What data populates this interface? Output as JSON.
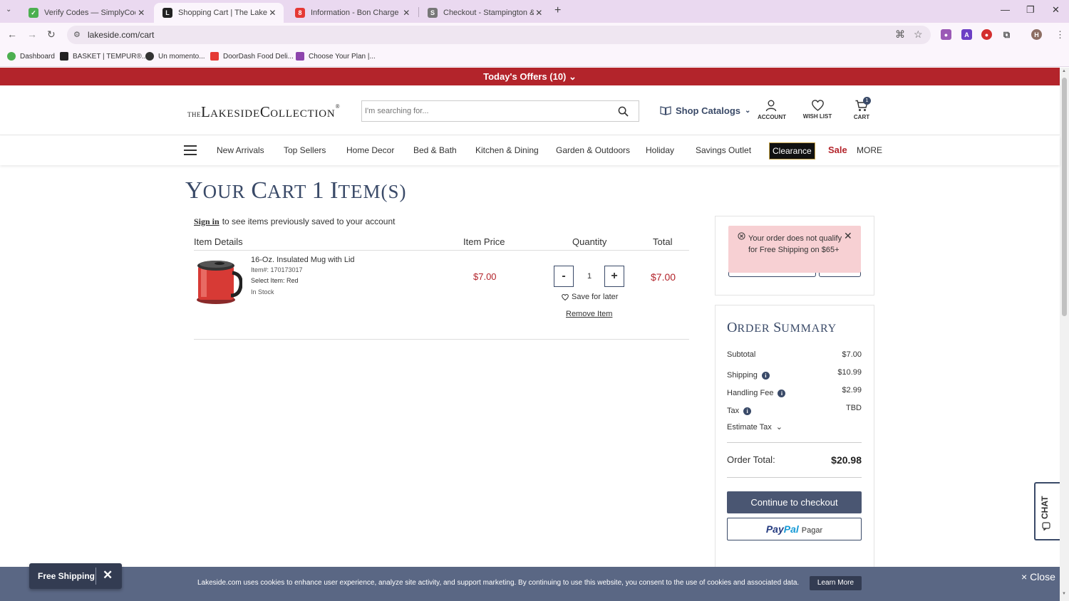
{
  "browser": {
    "tabs": [
      {
        "title": "Verify Codes — SimplyCodes",
        "fav_color": "#4caf50",
        "fav_glyph": "✓"
      },
      {
        "title": "Shopping Cart | The Lakeside C",
        "fav_color": "#222222",
        "fav_glyph": "L"
      },
      {
        "title": "Information - Bon Charge - Che",
        "fav_color": "#e53935",
        "fav_glyph": "8"
      },
      {
        "title": "Checkout - Stampington & Com",
        "fav_color": "#777777",
        "fav_glyph": "S"
      }
    ],
    "url": "lakeside.com/cart",
    "bookmarks": [
      {
        "label": "Dashboard",
        "color": "#4caf50"
      },
      {
        "label": "BASKET | TEMPUR®...",
        "color": "#222222"
      },
      {
        "label": "Un momento...",
        "color": "#333333"
      },
      {
        "label": "DoorDash Food Deli...",
        "color": "#e53935"
      },
      {
        "label": "Choose Your Plan |...",
        "color": "#8e44ad"
      }
    ]
  },
  "offers_banner": "Today's Offers (10) ⌄",
  "header": {
    "logo": {
      "the": "THE",
      "l": "L",
      "akeside": "AKESIDE",
      "c": "C",
      "ollection": "OLLECTION",
      "reg": "®"
    },
    "search_placeholder": "I'm searching for...",
    "shop_catalogs": "Shop Catalogs",
    "account": "ACCOUNT",
    "wishlist": "WISH LIST",
    "cart": "CART",
    "cart_count": "1"
  },
  "nav": [
    "New Arrivals",
    "Top Sellers",
    "Home Decor",
    "Bed & Bath",
    "Kitchen & Dining",
    "Garden & Outdoors",
    "Holiday",
    "Savings Outlet"
  ],
  "nav_clearance": "Clearance",
  "nav_sale": "Sale",
  "nav_more": "MORE",
  "cart": {
    "title_y": "Y",
    "title_our": "OUR ",
    "title_c": "C",
    "title_art": "ART ",
    "title_1": "1 ",
    "title_i": "I",
    "title_tems": "TEM(S)",
    "signin_link": "Sign in",
    "signin_text": "to see items previously saved to your account",
    "columns": {
      "details": "Item Details",
      "price": "Item Price",
      "quantity": "Quantity",
      "total": "Total"
    },
    "item": {
      "name": "16-Oz. Insulated Mug with Lid",
      "number": "Item#: 170173017",
      "select": "Select Item: Red",
      "stock": "In Stock",
      "price": "$7.00",
      "quantity": "1",
      "total": "$7.00",
      "save_later": "Save for later",
      "remove": "Remove Item"
    }
  },
  "alert": {
    "text": "Your order does not qualify for Free Shipping on $65+"
  },
  "summary": {
    "title_o": "O",
    "title_rder": "RDER ",
    "title_s": "S",
    "title_ummary": "UMMARY",
    "subtotal_label": "Subtotal",
    "subtotal": "$7.00",
    "shipping_label": "Shipping",
    "shipping": "$10.99",
    "handling_label": "Handling Fee",
    "handling": "$2.99",
    "tax_label": "Tax",
    "tax": "TBD",
    "estimate_tax": "Estimate Tax",
    "order_total_label": "Order Total:",
    "order_total": "$20.98",
    "checkout": "Continue to checkout",
    "paypal_1": "Pay",
    "paypal_2": "Pal",
    "paypal_pagar": "Pagar"
  },
  "chat": "CHAT",
  "cookie": {
    "text": "Lakeside.com uses cookies to enhance user experience, analyze site activity, and support marketing. By continuing to use this website, you consent to the use of cookies and associated data.",
    "learn_more": "Learn More",
    "close": "× Close"
  },
  "free_shipping": "Free Shipping"
}
